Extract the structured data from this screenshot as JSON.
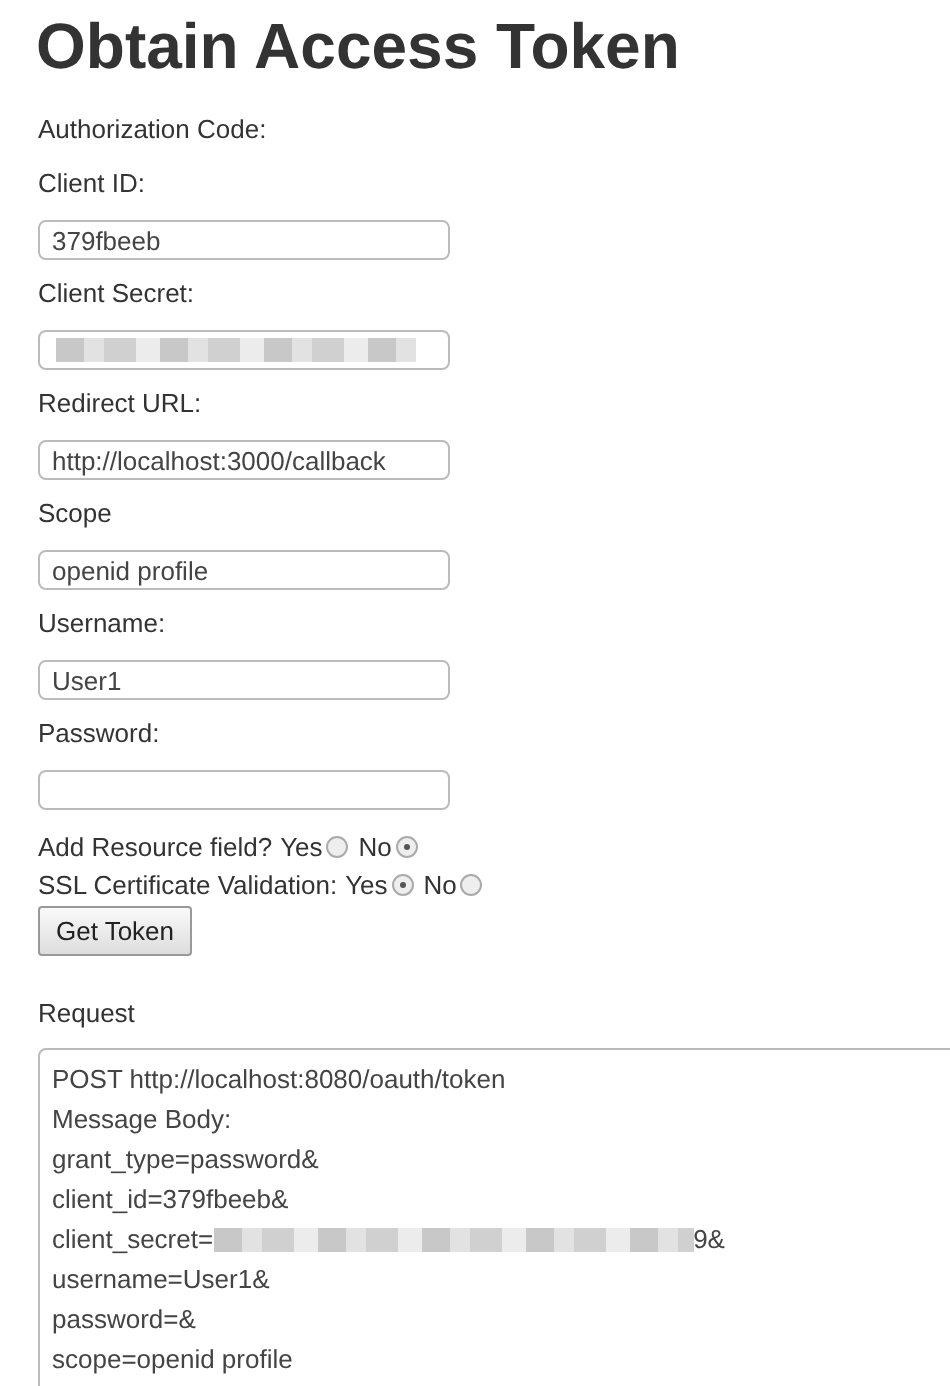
{
  "title": "Obtain Access Token",
  "authorization_code_label": "Authorization Code:",
  "fields": [
    {
      "label": "Client ID:",
      "kind": "text",
      "value": "379fbeeb"
    },
    {
      "label": "Client Secret:",
      "kind": "redacted"
    },
    {
      "label": "Redirect URL:",
      "kind": "text",
      "value": "http://localhost:3000/callback"
    },
    {
      "label": "Scope",
      "kind": "text",
      "value": "openid profile"
    },
    {
      "label": "Username:",
      "kind": "text",
      "value": "User1"
    },
    {
      "label": "Password:",
      "kind": "text"
    }
  ],
  "radio_groups": [
    {
      "label": "Add Resource field?",
      "options": [
        {
          "label": "Yes",
          "selected": false
        },
        {
          "label": "No",
          "selected": true
        }
      ]
    },
    {
      "label": "SSL Certificate Validation:",
      "options": [
        {
          "label": "Yes",
          "selected": true
        },
        {
          "label": "No",
          "selected": false
        }
      ]
    }
  ],
  "button": "Get Token",
  "request": {
    "label": "Request",
    "lines": [
      {
        "kind": "text",
        "text": "POST http://localhost:8080/oauth/token"
      },
      {
        "kind": "text",
        "text": "Message Body:"
      },
      {
        "kind": "text",
        "text": "grant_type=password&"
      },
      {
        "kind": "text",
        "text": "client_id=379fbeeb&"
      },
      {
        "kind": "redacted",
        "prefix": "client_secret=",
        "suffix": "9&"
      },
      {
        "kind": "text",
        "text": "username=User1&"
      },
      {
        "kind": "text",
        "text": "password=&"
      },
      {
        "kind": "text",
        "text": "scope=openid profile"
      }
    ]
  }
}
